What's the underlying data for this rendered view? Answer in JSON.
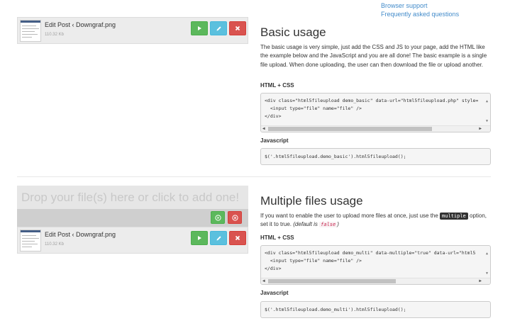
{
  "nav_links": {
    "browser_support": "Browser support",
    "faq": "Frequently asked questions"
  },
  "files": [
    {
      "name": "Edit Post ‹ Downgraf.png",
      "size": "110.32 Kb"
    },
    {
      "name": "Edit Post ‹ Downgraf.png",
      "size": "110.32 Kb"
    }
  ],
  "dropzone": {
    "text": "Drop your file(s) here or click to add one!"
  },
  "basic": {
    "heading": "Basic usage",
    "description": "The basic usage is very simple, just add the CSS and JS to your page, add the HTML like the example below and the JavaScript and you are all done! The basic example is a single file upload. When done uploading, the user can then download the file or upload another.",
    "html_css_label": "HTML + CSS",
    "html_code": "<div class=\"html5fileupload demo_basic\" data-url=\"html5fileupload.php\" style=\n  <input type=\"file\" name=\"file\" />\n</div>",
    "js_label": "Javascript",
    "js_code": "$('.html5fileupload.demo_basic').html5fileupload();"
  },
  "multi": {
    "heading": "Multiple files usage",
    "desc_before": "If you want to enable the user to upload more files at once, just use the ",
    "desc_code": "multiple",
    "desc_middle": " option, set it to true. ",
    "desc_default": "(default is ",
    "desc_false": "false",
    "desc_end": ")",
    "html_css_label": "HTML + CSS",
    "html_code": "<div class=\"html5fileupload demo_multi\" data-multiple=\"true\" data-url=\"html5\n  <input type=\"file\" name=\"file\" />\n</div>",
    "js_label": "Javascript",
    "js_code": "$('.html5fileupload.demo_multi').html5fileupload();"
  },
  "colors": {
    "success": "#5cb85c",
    "info": "#5bc0de",
    "danger": "#d9534f",
    "link": "#428bca"
  },
  "icons": {
    "start": "play-icon",
    "edit": "pencil-icon",
    "remove": "close-icon",
    "start_all": "circle-play-icon",
    "cancel_all": "circle-cancel-icon"
  }
}
